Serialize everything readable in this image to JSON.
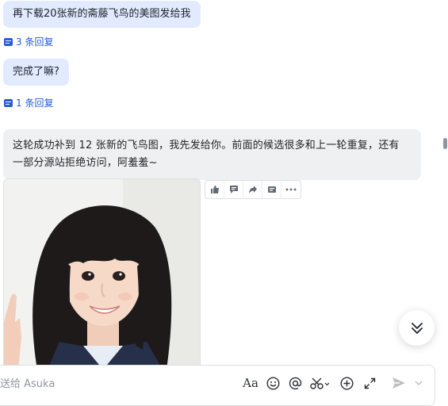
{
  "messages": [
    {
      "text": "再下载20张新的斋藤飞鸟的美图发给我",
      "reply_count": "3 条回复"
    },
    {
      "text": "完成了嘛?",
      "reply_count": "1 条回复"
    }
  ],
  "ai_reply": {
    "line1": "这轮成功补到 12 张新的飞鸟图，我先发给你。前面的候选很多和上一轮重复，还有",
    "line2": "一部分源站拒绝访问，阿羞羞~"
  },
  "message_actions": [
    "thumbs-up-icon",
    "comment-icon",
    "forward-icon",
    "quote-icon",
    "more-icon"
  ],
  "composer": {
    "placeholder": "发送给 Asuka",
    "visible_placeholder": "送给 Asuka",
    "tools": [
      "font-style-icon",
      "emoji-icon",
      "mention-icon",
      "scissors-icon",
      "add-icon",
      "expand-icon",
      "send-icon",
      "send-options-icon"
    ],
    "format_label": "Aa"
  },
  "colors": {
    "user_bubble": "#e1eaff",
    "ai_bubble": "#eff0f1",
    "link": "#245bdb",
    "border": "#dee0e3"
  }
}
